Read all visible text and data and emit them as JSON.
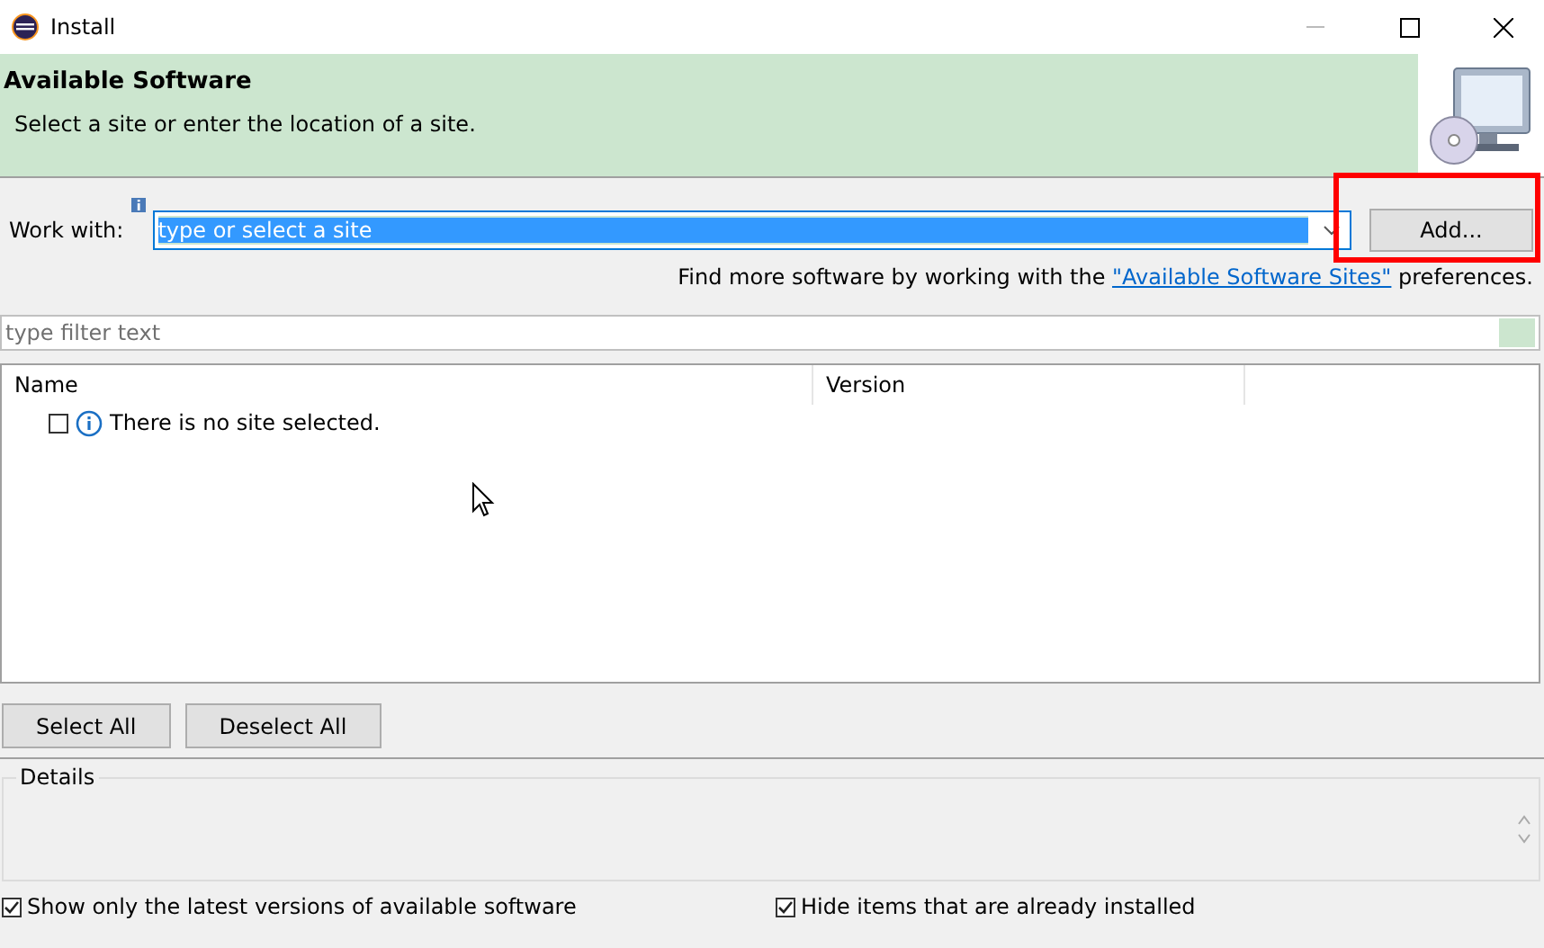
{
  "window": {
    "title": "Install"
  },
  "banner": {
    "title": "Available Software",
    "message": "Select a site or enter the location of a site."
  },
  "work_with": {
    "label": "Work with:",
    "placeholder": "type or select a site",
    "add_button": "Add...",
    "highlighted": true
  },
  "more_software": {
    "prefix": "Find more software by working with the ",
    "link": "\"Available Software Sites\"",
    "suffix": " preferences."
  },
  "filter": {
    "placeholder": "type filter text"
  },
  "table": {
    "columns": [
      "Name",
      "Version"
    ],
    "rows": [
      {
        "text": "There is no site selected.",
        "checked": false
      }
    ]
  },
  "buttons": [
    "Select All",
    "Deselect All"
  ],
  "details": {
    "label": "Details"
  },
  "options": [
    {
      "label": "Show only the latest versions of available software",
      "checked": true
    },
    {
      "label": "Hide items that are already installed",
      "checked": true
    }
  ]
}
